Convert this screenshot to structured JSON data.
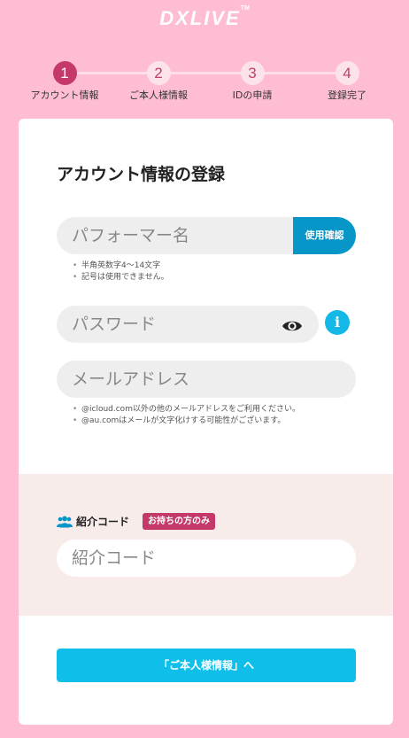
{
  "header": {
    "logo": "DXLIVE",
    "logo_mark": "TM"
  },
  "steps": [
    {
      "num": "1",
      "label": "アカウント情報",
      "active": true
    },
    {
      "num": "2",
      "label": "ご本人様情報",
      "active": false
    },
    {
      "num": "3",
      "label": "IDの申請",
      "active": false
    },
    {
      "num": "4",
      "label": "登録完了",
      "active": false
    }
  ],
  "form": {
    "title": "アカウント情報の登録",
    "performer_name": {
      "placeholder": "パフォーマー名",
      "check_button": "使用確認"
    },
    "performer_notes": [
      "半角英数字4～14文字",
      "記号は使用できません。"
    ],
    "password": {
      "placeholder": "パスワード",
      "icon": "eye-icon",
      "info_icon": "info-icon",
      "info_glyph": "i"
    },
    "email": {
      "placeholder": "メールアドレス"
    },
    "email_notes": [
      "@icloud.com以外の他のメールアドレスをご利用ください。",
      "@au.comはメールが文字化けする可能性がございます。"
    ]
  },
  "referral": {
    "icon": "users-icon",
    "label": "紹介コード",
    "badge": "お持ちの方のみ",
    "placeholder": "紹介コード"
  },
  "next_button": "「ご本人様情報」へ",
  "colors": {
    "background": "#ffbdd4",
    "step_active": "#c5386a",
    "check_button": "#0896c8",
    "info_icon": "#14b8e6",
    "next_button": "#10bfe9",
    "referral_bg": "#f7ece9"
  }
}
